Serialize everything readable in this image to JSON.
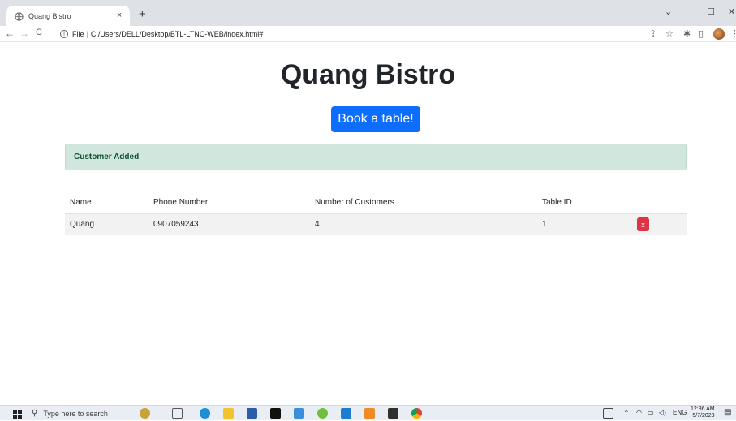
{
  "browser": {
    "tab_title": "Quang Bistro",
    "tab_close": "×",
    "new_tab": "+",
    "back": "←",
    "forward": "→",
    "reload": "C",
    "url_prefix": "File",
    "url_separator": "|",
    "url": "C:/Users/DELL/Desktop/BTL-LTNC-WEB/index.html#",
    "minimize": "−",
    "maximize": "☐",
    "close": "✕",
    "tab_list": "⌄"
  },
  "page": {
    "title": "Quang Bistro",
    "book_button": "Book a table!",
    "alert": "Customer Added",
    "table": {
      "headers": [
        "Name",
        "Phone Number",
        "Number of Customers",
        "Table ID",
        ""
      ],
      "rows": [
        {
          "name": "Quang",
          "phone": "0907059243",
          "customers": "4",
          "table_id": "1",
          "delete_label": "x"
        }
      ]
    }
  },
  "taskbar": {
    "search_placeholder": "Type here to search",
    "language": "ENG",
    "time": "12:36 AM",
    "date": "5/7/2023"
  },
  "colors": {
    "primary": "#0d6efd",
    "success_bg": "#d1e7dd",
    "danger": "#dc3545"
  }
}
